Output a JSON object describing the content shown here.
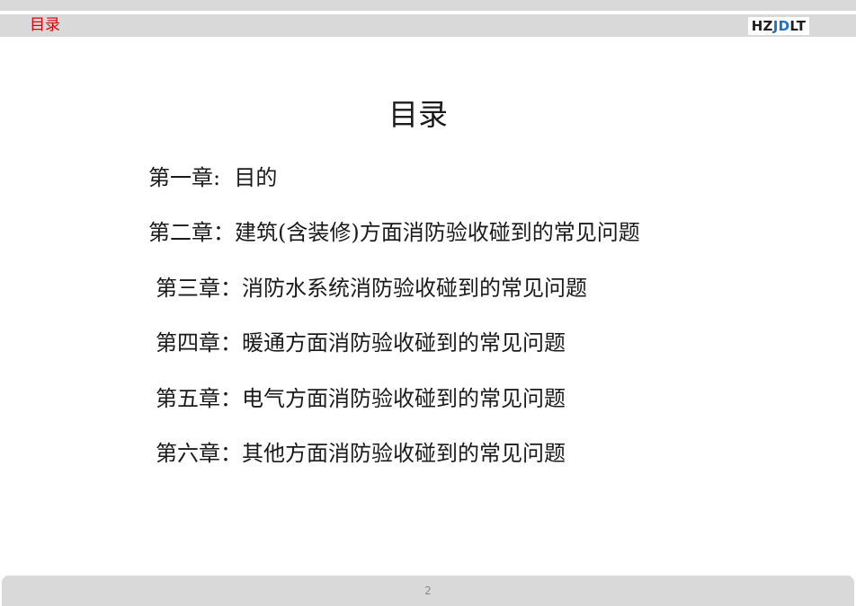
{
  "header": {
    "title": "目录",
    "logo": {
      "part1": "HZ",
      "part2": "JD",
      "part3": "LT"
    },
    "title_color": "#e00000",
    "logo_accent_color": "#1a72c9"
  },
  "main": {
    "title": "目录",
    "toc": [
      "第一章:  目的",
      "第二章：建筑(含装修)方面消防验收碰到的常见问题",
      "第三章：消防水系统消防验收碰到的常见问题",
      "第四章：暖通方面消防验收碰到的常见问题",
      "第五章：电气方面消防验收碰到的常见问题",
      "第六章：其他方面消防验收碰到的常见问题"
    ]
  },
  "footer": {
    "page_number": "2"
  }
}
